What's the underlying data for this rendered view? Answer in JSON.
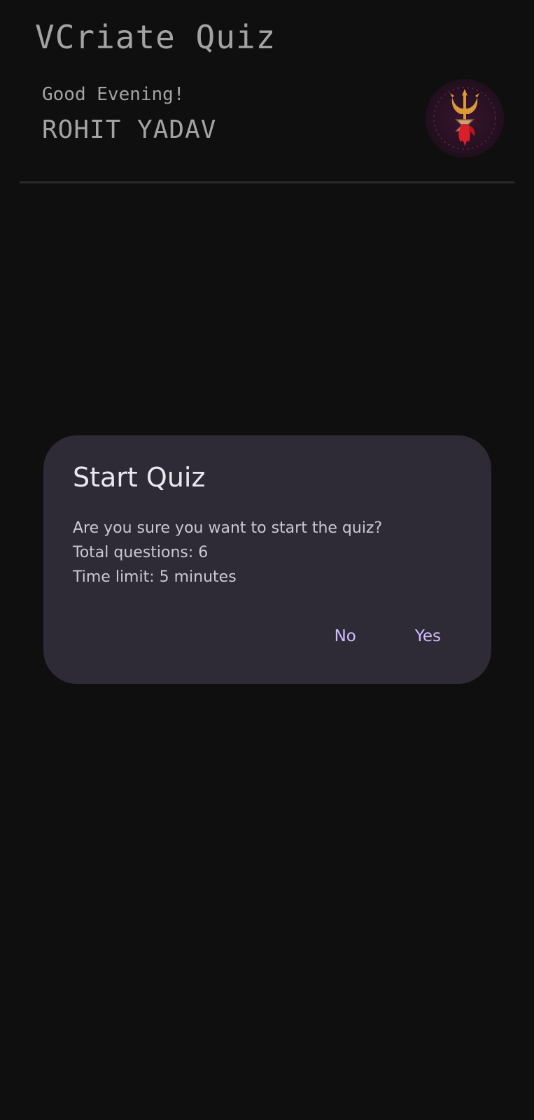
{
  "app": {
    "title": "VCriate Quiz"
  },
  "header": {
    "greeting": "Good Evening!",
    "user_name": "ROHIT YADAV",
    "avatar_icon": "trishul-damaru-icon"
  },
  "dialog": {
    "title": "Start Quiz",
    "lines": [
      "Are you sure you want to start the quiz?",
      "Total questions: 6",
      "Time limit: 5 minutes"
    ],
    "no_label": "No",
    "yes_label": "Yes"
  },
  "colors": {
    "background": "#0f0f10",
    "dialog_background": "#2f2b36",
    "accent": "#d0bcff",
    "header_text": "#a3a3a3"
  }
}
